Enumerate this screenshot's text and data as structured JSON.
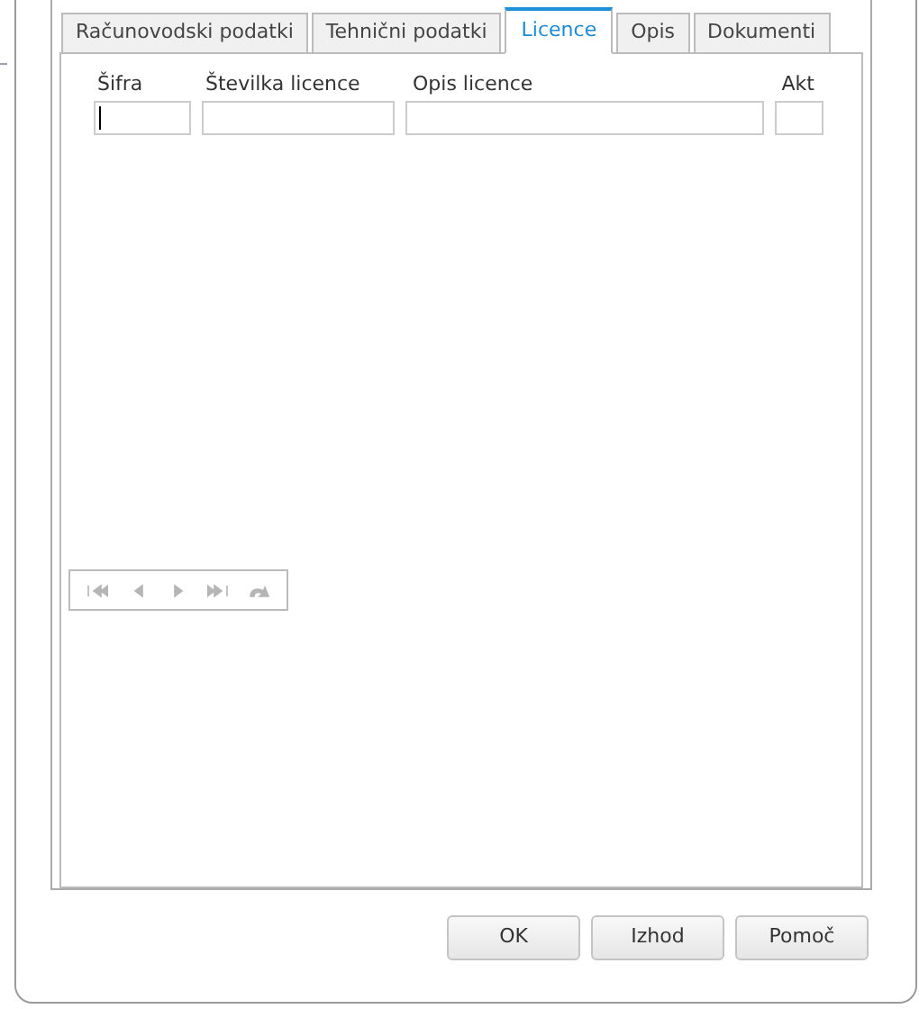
{
  "tabs": [
    {
      "label": "Računovodski podatki",
      "selected": false
    },
    {
      "label": "Tehnični podatki",
      "selected": false
    },
    {
      "label": "Licence",
      "selected": true
    },
    {
      "label": "Opis",
      "selected": false
    },
    {
      "label": "Dokumenti",
      "selected": false
    }
  ],
  "table": {
    "columns": [
      {
        "label": "Šifra",
        "focused": true
      },
      {
        "label": "Številka licence",
        "focused": false
      },
      {
        "label": "Opis licence",
        "focused": false
      },
      {
        "label": "Akt",
        "focused": false
      }
    ]
  },
  "pager": {
    "disabled": true
  },
  "buttons": [
    {
      "label": "OK"
    },
    {
      "label": "Izhod"
    },
    {
      "label": "Pomoč"
    }
  ]
}
